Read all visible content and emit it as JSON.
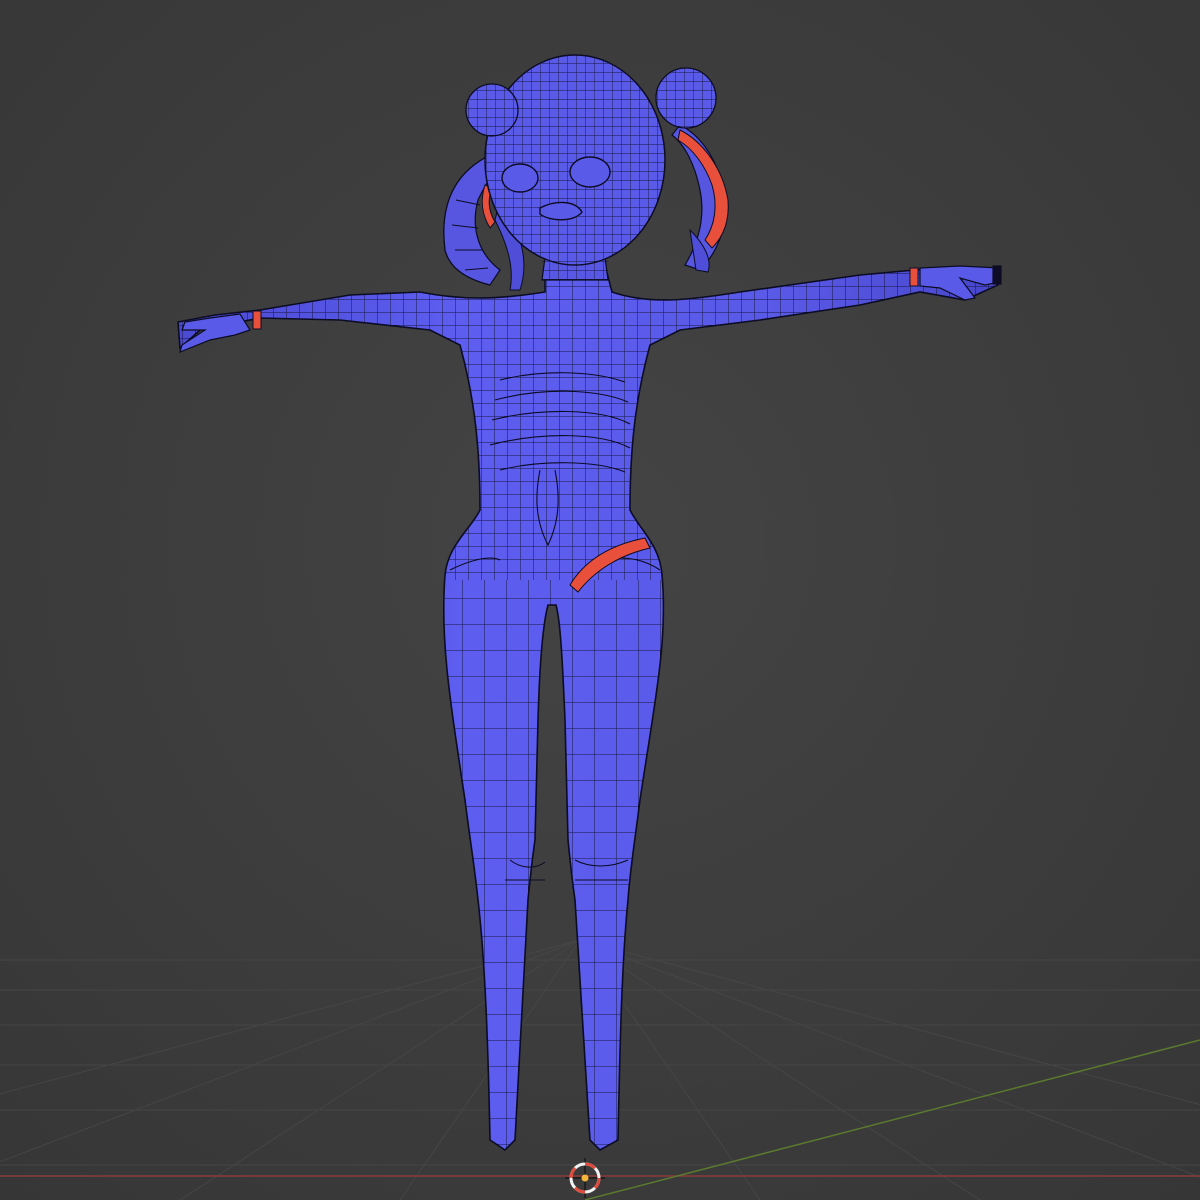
{
  "viewport": {
    "type": "3d-viewport",
    "background_color": "#3d3d3d",
    "grid_line_color": "#474747",
    "x_axis_color": "#8a3b3b",
    "y_axis_color": "#5b7a2e"
  },
  "model": {
    "description_icon": "character-mesh",
    "pose": "T-pose",
    "face_color": "#5a5ae8",
    "face_shade_color": "#4a4ad4",
    "wire_color": "#0c0c24",
    "seam_color": "#e8503c"
  },
  "cursor": {
    "icon": "3d-cursor-icon",
    "ring_color_a": "#e04a3a",
    "ring_color_b": "#f2f2f2",
    "center_color": "#f4b63a"
  }
}
